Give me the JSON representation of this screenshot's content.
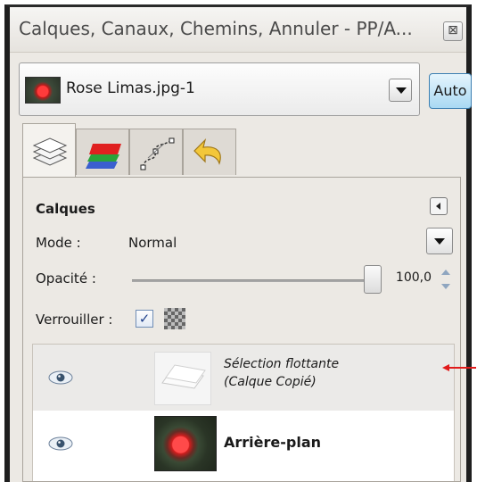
{
  "window": {
    "title": "Calques, Canaux, Chemins, Annuler - PP/A...",
    "close_label": "⊠"
  },
  "image_bar": {
    "image_name": "Rose Limas.jpg-1",
    "auto_label": "Auto"
  },
  "tabs": [
    {
      "name": "layers",
      "icon": "layers-icon"
    },
    {
      "name": "channels",
      "icon": "channels-icon"
    },
    {
      "name": "paths",
      "icon": "paths-icon"
    },
    {
      "name": "undo",
      "icon": "undo-icon"
    }
  ],
  "layers_panel": {
    "title": "Calques",
    "mode_label": "Mode :",
    "mode_value": "Normal",
    "opacity_label": "Opacité :",
    "opacity_value": "100,0",
    "lock_label": "Verrouiller :",
    "lock_pixels_checked": true,
    "check_glyph": "✓"
  },
  "layers": [
    {
      "name_line1": "Sélection flottante",
      "name_line2": "(Calque Copié)",
      "visible": true,
      "selected": true
    },
    {
      "name_line1": "Arrière-plan",
      "visible": true,
      "selected": false
    }
  ],
  "colors": {
    "accent": "#3c7fb1",
    "annotation_arrow": "#e11b1b"
  }
}
